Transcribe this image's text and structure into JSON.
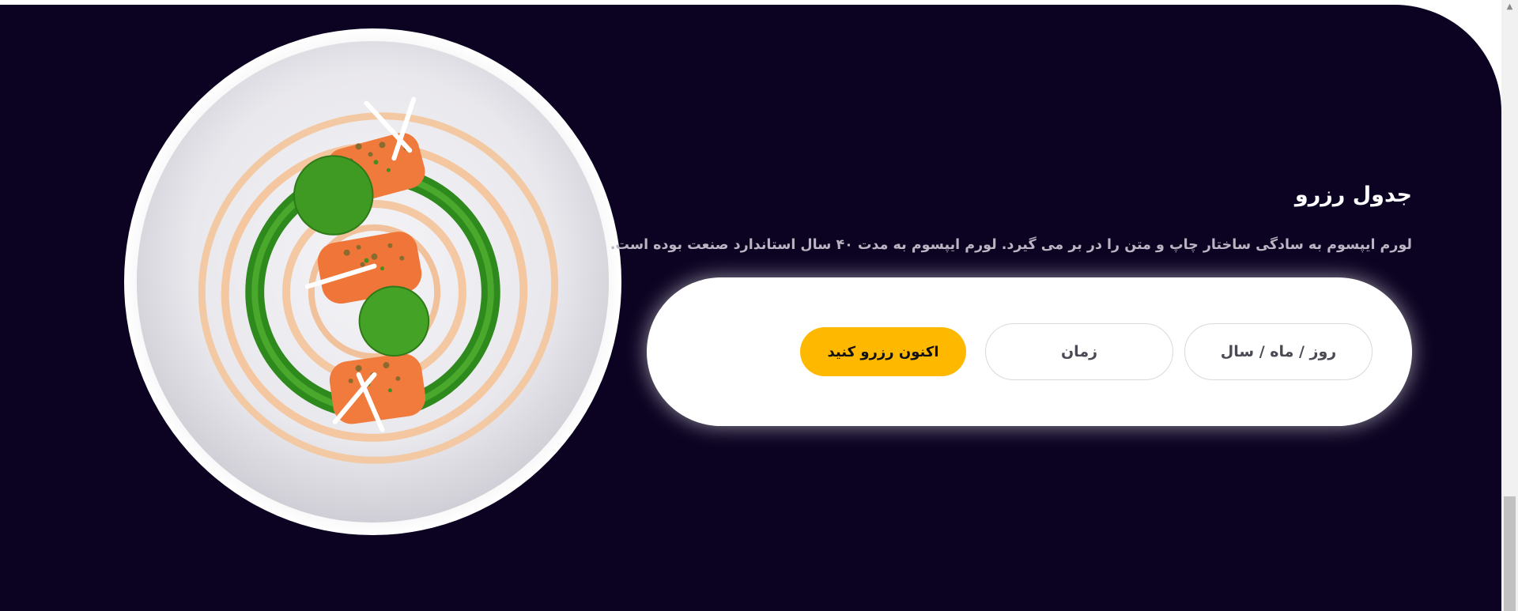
{
  "reservation": {
    "title": "جدول رزرو",
    "description": "لورم ایپسوم به سادگی ساختار چاپ و متن را در بر می گیرد. لورم ایپسوم به مدت ۴۰ سال استاندارد صنعت بوده است.",
    "date_placeholder": "روز / ماه / سال",
    "time_placeholder": "زمان",
    "reserve_button_label": "اکنون رزرو کنید"
  },
  "colors": {
    "section_background": "#0c0322",
    "accent": "#ffb800",
    "card": "#ffffff"
  },
  "icons": {
    "scroll_up": "caret-up-icon"
  }
}
